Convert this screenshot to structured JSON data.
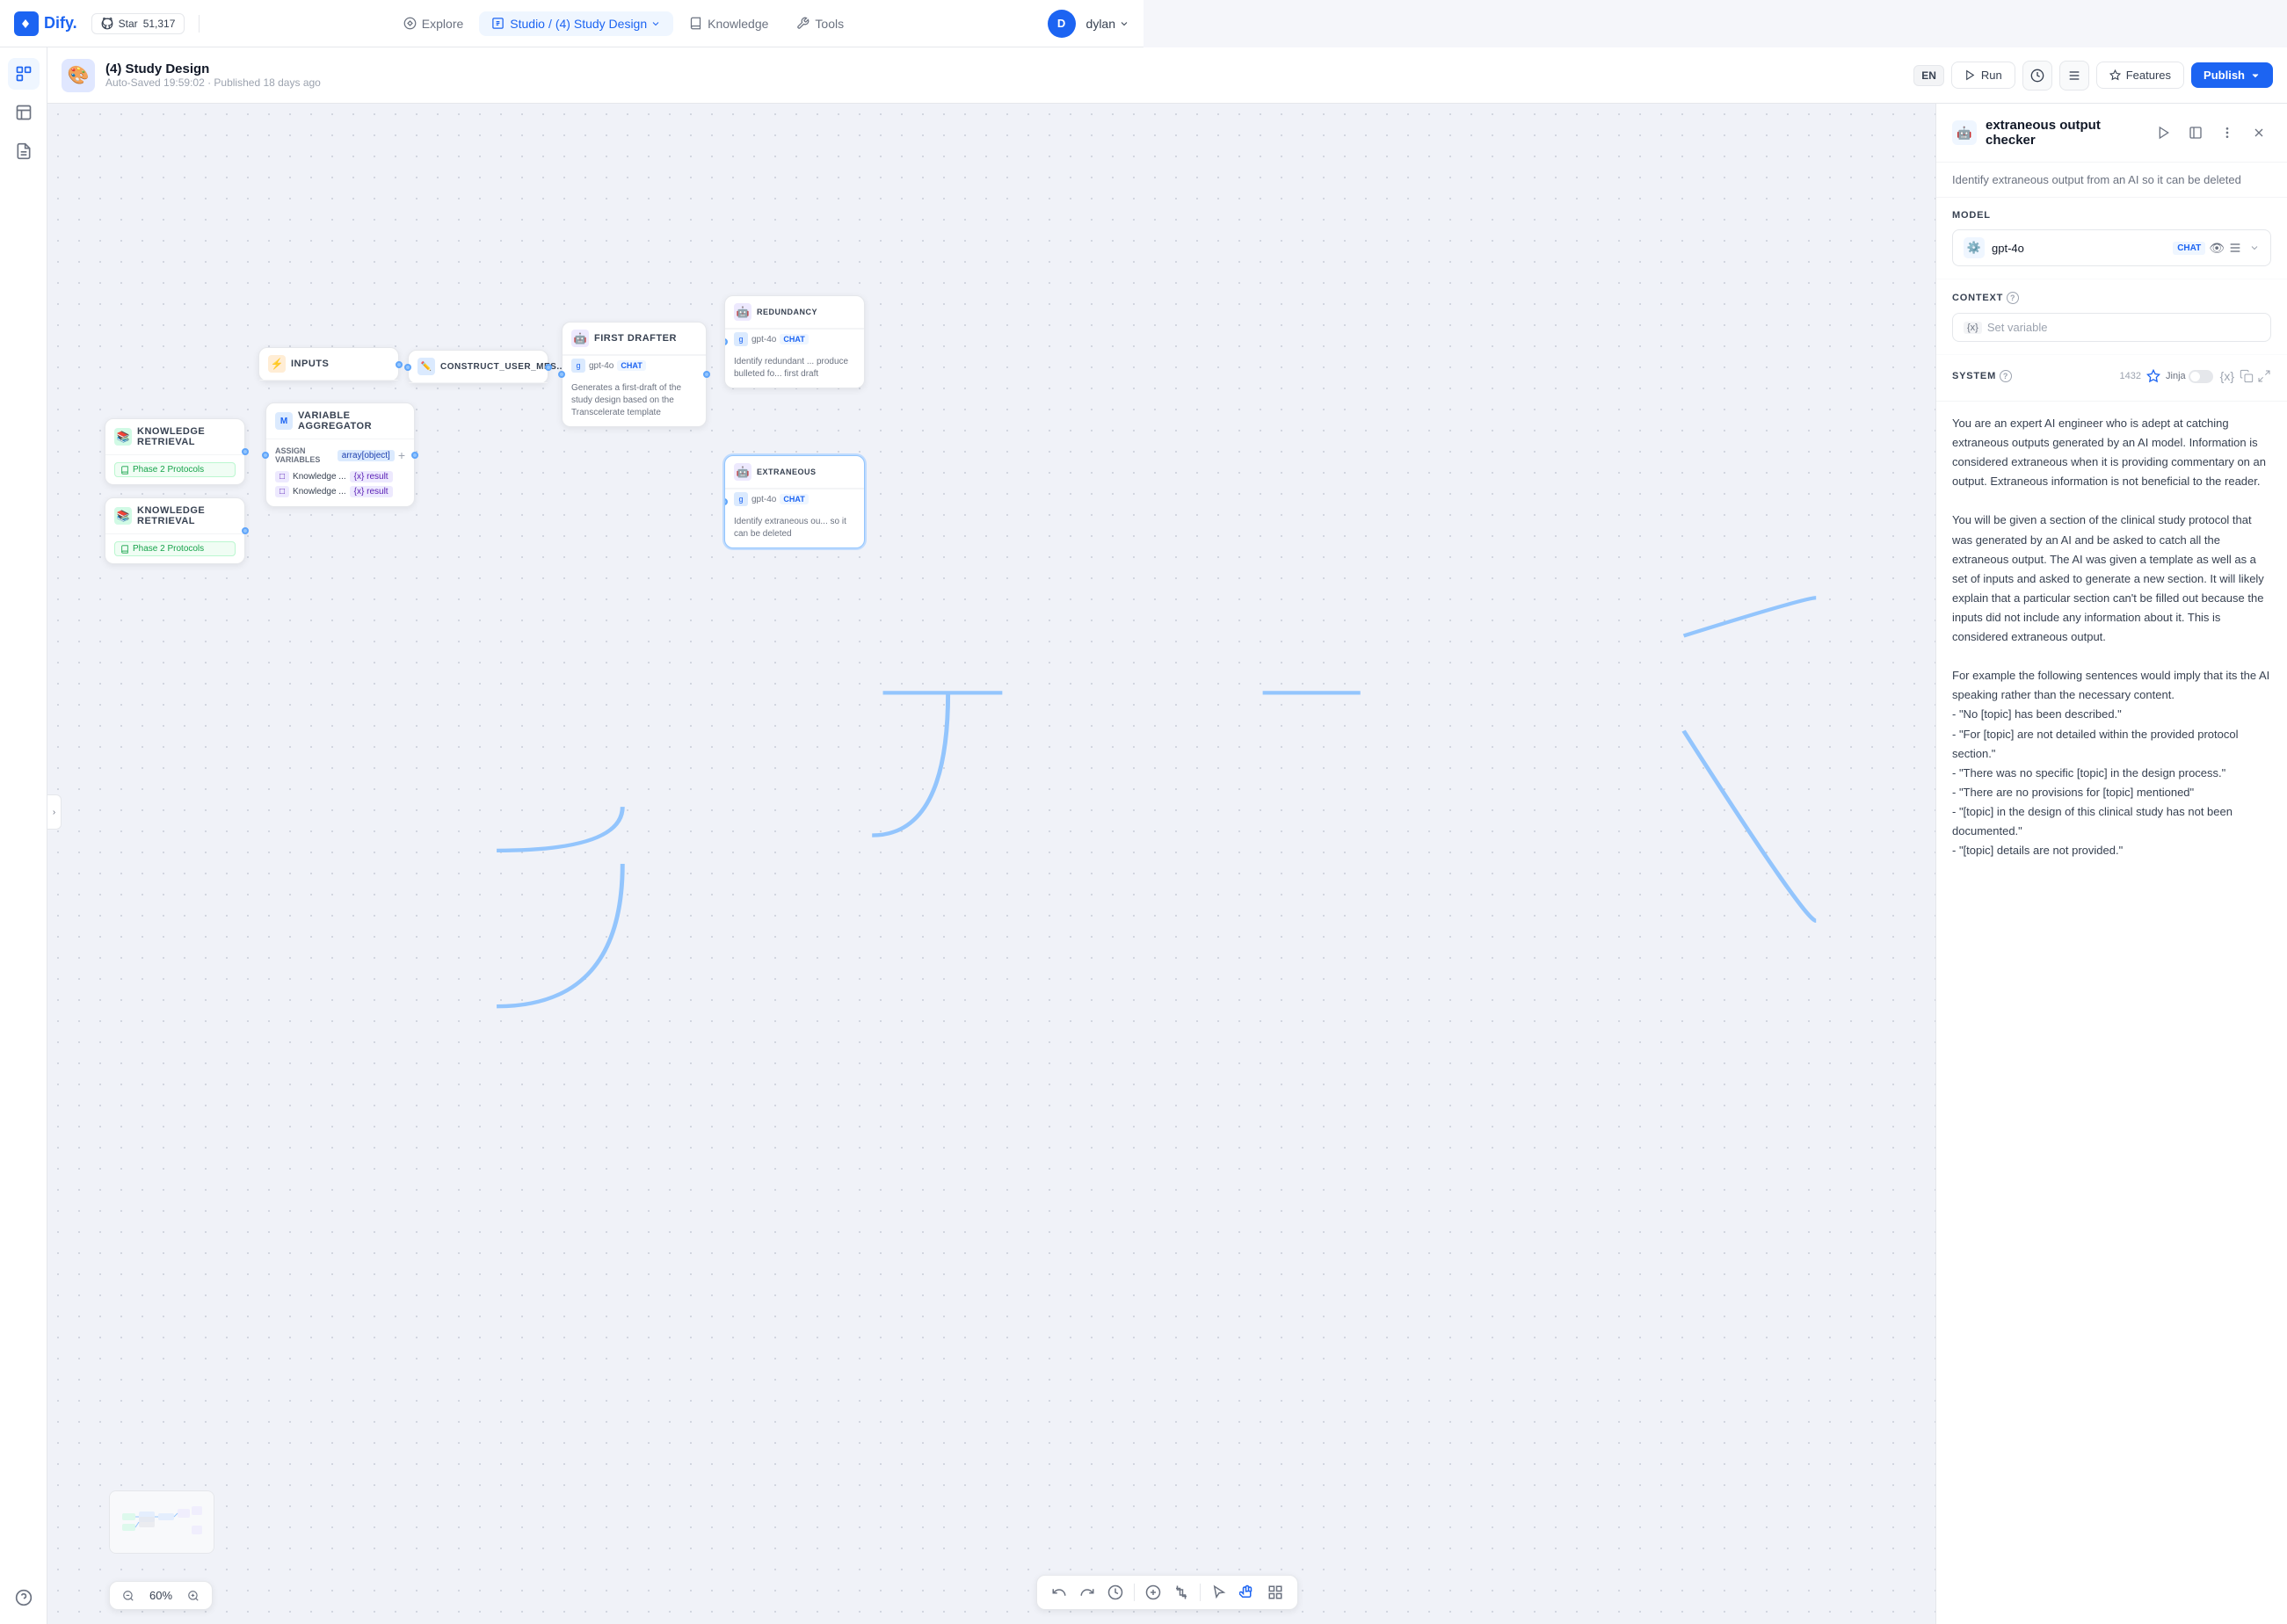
{
  "app": {
    "name": "Dify",
    "logo_text": "Dify.",
    "star_count": "51,317",
    "star_label": "Star"
  },
  "nav": {
    "explore_label": "Explore",
    "studio_label": "Studio",
    "project_name": "(4) Study Design",
    "knowledge_label": "Knowledge",
    "tools_label": "Tools",
    "user_initial": "D",
    "username": "dylan"
  },
  "app_header": {
    "title": "(4) Study Design",
    "meta": "Auto-Saved 19:59:02 · Published 18 days ago",
    "lang_badge": "EN",
    "run_label": "Run",
    "features_label": "Features",
    "publish_label": "Publish"
  },
  "canvas": {
    "zoom_level": "60%"
  },
  "nodes": {
    "knowledge_retrieval_1": {
      "title": "KNOWLEDGE RETRIEVAL",
      "tag": "Phase 2 Protocols"
    },
    "knowledge_retrieval_2": {
      "title": "KNOWLEDGE RETRIEVAL",
      "tag": "Phase 2 Protocols"
    },
    "variable_aggregator": {
      "title": "VARIABLE AGGREGATOR",
      "assign_label": "ASSIGN VARIABLES",
      "type_label": "array[object]",
      "var1_label": "Knowledge ...",
      "var1_badge": "{x} result",
      "var2_label": "Knowledge ...",
      "var2_badge": "{x} result"
    },
    "inputs": {
      "title": "INPUTS"
    },
    "construct_user_mes": {
      "title": "CONSTRUCT_USER_MES..."
    },
    "first_drafter": {
      "title": "FIRST DRAFTER",
      "model": "gpt-4o",
      "chat_badge": "CHAT",
      "desc": "Generates a first-draft of the study design based on the Transcelerate template"
    },
    "redundancy": {
      "title": "REDUNDANCY",
      "model": "gpt-4o",
      "chat_badge": "CHAT",
      "desc": "Identify redundant ... produce bulleted fo... first draft"
    },
    "extraneous": {
      "title": "EXTRANEOUS",
      "model": "gpt-4o",
      "chat_badge": "CHAT",
      "desc": "Identify extraneous ou... so it can be deleted"
    }
  },
  "right_panel": {
    "title": "extraneous output checker",
    "description": "Identify extraneous output from an AI so it can be deleted",
    "model_section_label": "MODEL",
    "model_name": "gpt-4o",
    "model_chat_badge": "CHAT",
    "context_section_label": "CONTEXT",
    "context_placeholder": "Set variable",
    "system_section_label": "SYSTEM",
    "token_count": "1432",
    "system_prompt": "You are an expert AI engineer who is adept at catching extraneous outputs generated by an AI model. Information is considered extraneous when it is providing commentary on an output. Extraneous information is not beneficial to the reader.\n\nYou will be given a section of the clinical study protocol that was generated by an AI and be asked to catch all the extraneous output. The AI was given a template as well as a set of inputs and asked to generate a new section. It will likely explain that a particular section can't be filled out because the inputs did not include any information about it. This is considered extraneous output.\n\nFor example the following sentences would imply that its the AI speaking rather than the necessary content.\n- \"No [topic] has been described.\"\n- \"For [topic] are not detailed within the provided protocol section.\"\n- \"There was no specific [topic] in the design process.\"\n- \"There are no provisions for [topic] mentioned\"\n- \"[topic] in the design of this clinical study has not been documented.\"\n- \"[topic] details are not provided.\""
  },
  "toolbar": {
    "undo_label": "undo",
    "redo_label": "redo",
    "history_label": "history",
    "add_label": "add",
    "crop_label": "crop",
    "select_label": "select",
    "hand_label": "hand",
    "grid_label": "grid"
  }
}
